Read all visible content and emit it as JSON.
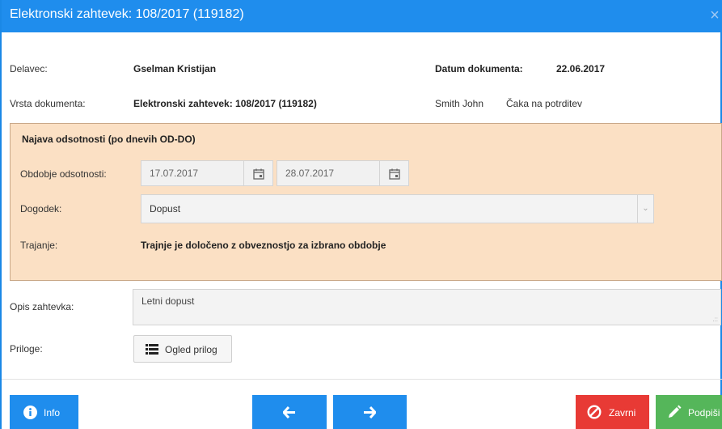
{
  "window": {
    "title": "Elektronski zahtevek: 108/2017 (119182)",
    "close": "×"
  },
  "header": {
    "worker_label": "Delavec:",
    "worker_value": "Gselman Kristijan",
    "doc_date_label": "Datum dokumenta:",
    "doc_date_value": "22.06.2017",
    "doc_type_label": "Vrsta dokumenta:",
    "doc_type_value": "Elektronski zahtevek: 108/2017 (119182)",
    "approver": "Smith John",
    "status": "Čaka na potrditev"
  },
  "absence": {
    "title": "Najava odsotnosti (po dnevih OD-DO)",
    "period_label": "Obdobje odsotnosti:",
    "date_from": "17.07.2017",
    "date_to": "28.07.2017",
    "event_label": "Dogodek:",
    "event_value": "Dopust",
    "duration_label": "Trajanje:",
    "duration_value": "Trajnje je določeno z obveznostjo za izbrano obdobje"
  },
  "request": {
    "description_label": "Opis zahtevka:",
    "description_value": "Letni dopust",
    "attachments_label": "Priloge:",
    "attachments_button": "Ogled prilog"
  },
  "footer": {
    "info": "Info",
    "close": "Zavrni",
    "sign": "Podpiši"
  },
  "colors": {
    "primary": "#1f8ded",
    "danger": "#e83a35",
    "success": "#55b65a",
    "panel": "#fbe0c4"
  }
}
